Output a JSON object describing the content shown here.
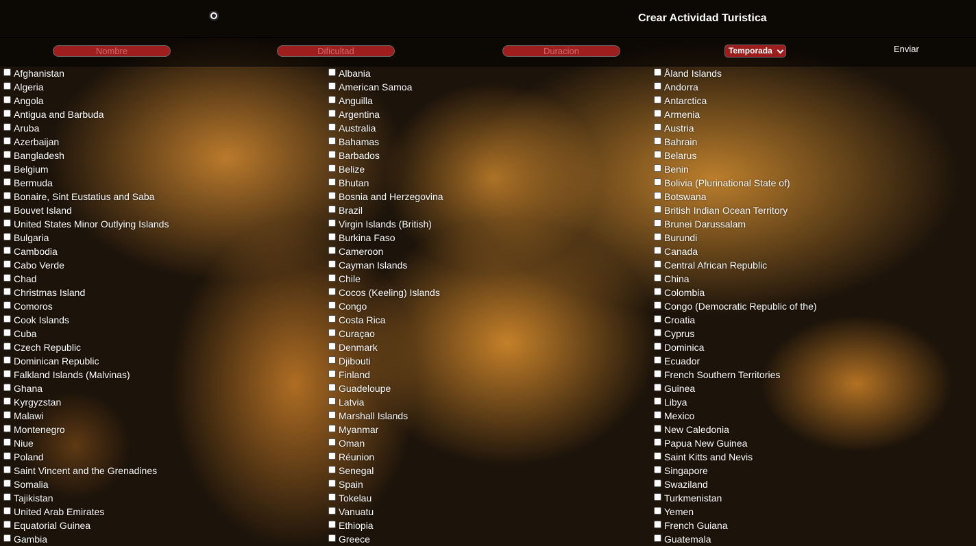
{
  "header": {
    "title": "Crear Actividad Turistica",
    "logo_icon": "globe-icon"
  },
  "form": {
    "name_placeholder": "Nombre",
    "difficulty_placeholder": "Dificultad",
    "duration_placeholder": "Duracion",
    "season_selected": "Temporada",
    "submit_label": "Enviar",
    "accent_color": "#9e1d1d"
  },
  "countries": {
    "col1": [
      "Afghanistan",
      "Algeria",
      "Angola",
      "Antigua and Barbuda",
      "Aruba",
      "Azerbaijan",
      "Bangladesh",
      "Belgium",
      "Bermuda",
      "Bonaire, Sint Eustatius and Saba",
      "Bouvet Island",
      "United States Minor Outlying Islands",
      "Bulgaria",
      "Cambodia",
      "Cabo Verde",
      "Chad",
      "Christmas Island",
      "Comoros",
      "Cook Islands",
      "Cuba",
      "Czech Republic",
      "Dominican Republic",
      "Falkland Islands (Malvinas)",
      "Ghana",
      "Kyrgyzstan",
      "Malawi",
      "Montenegro",
      "Niue",
      "Poland",
      "Saint Vincent and the Grenadines",
      "Somalia",
      "Tajikistan",
      "United Arab Emirates",
      "Equatorial Guinea",
      "Gambia"
    ],
    "col2": [
      "Albania",
      "American Samoa",
      "Anguilla",
      "Argentina",
      "Australia",
      "Bahamas",
      "Barbados",
      "Belize",
      "Bhutan",
      "Bosnia and Herzegovina",
      "Brazil",
      "Virgin Islands (British)",
      "Burkina Faso",
      "Cameroon",
      "Cayman Islands",
      "Chile",
      "Cocos (Keeling) Islands",
      "Congo",
      "Costa Rica",
      "Curaçao",
      "Denmark",
      "Djibouti",
      "Finland",
      "Guadeloupe",
      "Latvia",
      "Marshall Islands",
      "Myanmar",
      "Oman",
      "Réunion",
      "Senegal",
      "Spain",
      "Tokelau",
      "Vanuatu",
      "Ethiopia",
      "Greece"
    ],
    "col3": [
      "Åland Islands",
      "Andorra",
      "Antarctica",
      "Armenia",
      "Austria",
      "Bahrain",
      "Belarus",
      "Benin",
      "Bolivia (Plurinational State of)",
      "Botswana",
      "British Indian Ocean Territory",
      "Brunei Darussalam",
      "Burundi",
      "Canada",
      "Central African Republic",
      "China",
      "Colombia",
      "Congo (Democratic Republic of the)",
      "Croatia",
      "Cyprus",
      "Dominica",
      "Ecuador",
      "French Southern Territories",
      "Guinea",
      "Libya",
      "Mexico",
      "New Caledonia",
      "Papua New Guinea",
      "Saint Kitts and Nevis",
      "Singapore",
      "Swaziland",
      "Turkmenistan",
      "Yemen",
      "French Guiana",
      "Guatemala"
    ]
  }
}
